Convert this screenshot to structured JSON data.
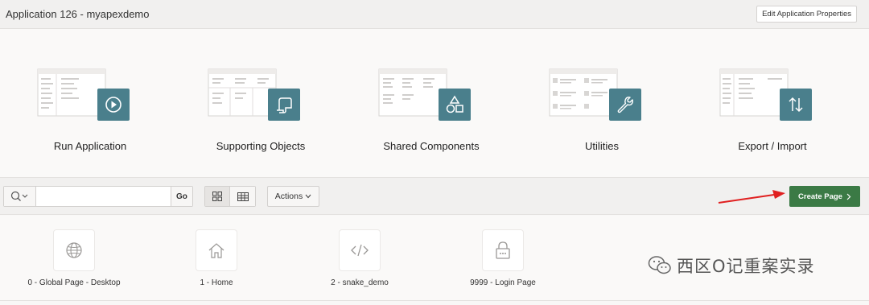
{
  "header": {
    "title": "Application 126 - myapexdemo",
    "edit_button": "Edit Application Properties"
  },
  "tiles": [
    {
      "label": "Run Application",
      "icon": "play-icon"
    },
    {
      "label": "Supporting Objects",
      "icon": "scroll-icon"
    },
    {
      "label": "Shared Components",
      "icon": "shapes-icon"
    },
    {
      "label": "Utilities",
      "icon": "wrench-icon"
    },
    {
      "label": "Export / Import",
      "icon": "up-down-arrows-icon"
    }
  ],
  "toolbar": {
    "search_value": "",
    "search_placeholder": "",
    "go_label": "Go",
    "actions_label": "Actions",
    "create_page_label": "Create Page",
    "view_mode": "icons"
  },
  "pages": [
    {
      "label": "0 - Global Page - Desktop",
      "icon": "globe-icon"
    },
    {
      "label": "1 - Home",
      "icon": "home-icon"
    },
    {
      "label": "2 - snake_demo",
      "icon": "code-icon"
    },
    {
      "label": "9999 - Login Page",
      "icon": "lock-icon"
    }
  ],
  "watermark": {
    "text": "西区O记重案实录"
  },
  "colors": {
    "accent_teal": "#4a7f8c",
    "create_green": "#3b7a45",
    "annotation_red": "#e02020"
  }
}
